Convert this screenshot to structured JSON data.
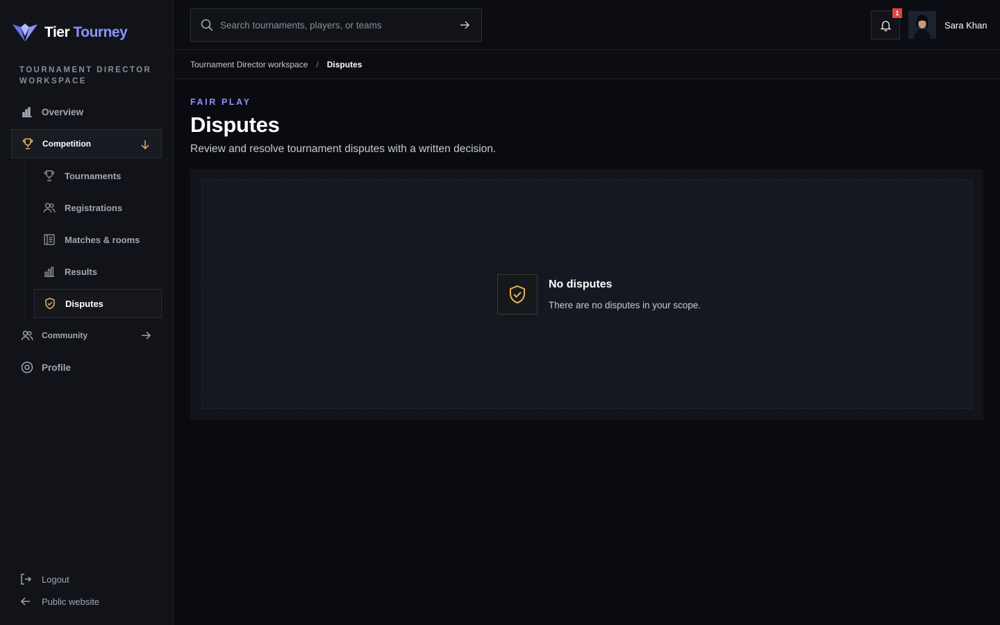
{
  "brand": {
    "name_part1": "Tier",
    "name_part2": "Tourney"
  },
  "sidebar": {
    "workspace_label": "TOURNAMENT DIRECTOR WORKSPACE",
    "overview": "Overview",
    "competition": "Competition",
    "sub_items": [
      "Tournaments",
      "Registrations",
      "Matches & rooms",
      "Results",
      "Disputes"
    ],
    "community": "Community",
    "profile": "Profile",
    "logout": "Logout",
    "public_website": "Public website"
  },
  "topbar": {
    "search_placeholder": "Search tournaments, players, or teams",
    "notification_count": "1",
    "user_name": "Sara Khan"
  },
  "breadcrumb": {
    "root": "Tournament Director workspace",
    "separator": "/",
    "current": "Disputes"
  },
  "main": {
    "eyebrow": "FAIR PLAY",
    "title": "Disputes",
    "subtitle": "Review and resolve tournament disputes with a written decision.",
    "empty_title": "No disputes",
    "empty_text": "There are no disputes in your scope."
  },
  "colors": {
    "accent": "#8b93ff",
    "gold": "#e5b45a",
    "badge": "#e04444"
  }
}
